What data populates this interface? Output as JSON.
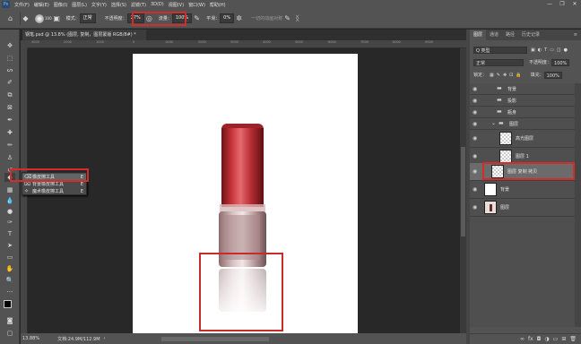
{
  "menubar": {
    "items": [
      "文件(F)",
      "编辑(E)",
      "图像(I)",
      "图层(L)",
      "文字(Y)",
      "选择(S)",
      "滤镜(T)",
      "3D(D)",
      "视图(V)",
      "窗口(W)",
      "帮助(H)"
    ],
    "window_controls": [
      "—",
      "❐",
      "✕"
    ]
  },
  "options": {
    "brush_size": "100",
    "mode_label": "模式：",
    "mode_value": "正常",
    "opacity_label": "不透明度：",
    "opacity_value": "27%",
    "flow_label": "流量：",
    "flow_value": "100%",
    "smooth_label": "平滑：",
    "smooth_value": "0%",
    "sym_label": "一切的动画对称"
  },
  "document": {
    "tab_title": "钢笔.psd @ 13.8% (图层, 复制，图层蒙版 RGB/8#) *",
    "zoom": "13.88%",
    "doc_size": "文档:24.9M/112.9M"
  },
  "ruler_ticks": [
    "3000",
    "2000",
    "1000",
    "0",
    "1000",
    "2000",
    "3000",
    "4000",
    "5000",
    "6000",
    "7000",
    "8000",
    "9000"
  ],
  "flyout": {
    "items": [
      {
        "icon": "⌫",
        "label": "橡皮擦工具",
        "key": "E"
      },
      {
        "icon": "⌧",
        "label": "背景橡皮擦工具",
        "key": "E"
      },
      {
        "icon": "✧",
        "label": "魔术橡皮擦工具",
        "key": "E"
      }
    ]
  },
  "panel": {
    "tabs": [
      "图层",
      "通道",
      "路径",
      "历史记录"
    ],
    "filter_label": "Q 类型",
    "blend_mode": "正常",
    "opacity_label": "不透明度：",
    "opacity_value": "100%",
    "lock_label": "锁定：",
    "fill_label": "填充：",
    "fill_value": "100%",
    "layers": [
      {
        "name": "背景",
        "type": "group"
      },
      {
        "name": "投影",
        "type": "group"
      },
      {
        "name": "瓶身",
        "type": "group"
      },
      {
        "name": "图层",
        "type": "group"
      },
      {
        "name": "高光图层",
        "type": "layer"
      },
      {
        "name": "图层 1",
        "type": "layer"
      },
      {
        "name": "图层 复制 拷贝",
        "type": "layer",
        "selected": true
      },
      {
        "name": "背景",
        "type": "white"
      },
      {
        "name": "图层",
        "type": "photo"
      }
    ],
    "footer_icons": [
      "∞",
      "fx",
      "◘",
      "◑",
      "▭",
      "⊞",
      "🗑"
    ]
  },
  "colors": {
    "highlight": "#d42b2b",
    "cap_red": "#b52a30",
    "canvas": "#ffffff"
  }
}
